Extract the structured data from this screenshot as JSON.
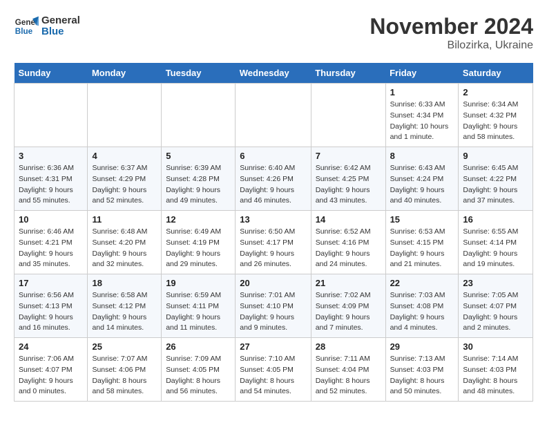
{
  "logo": {
    "line1": "General",
    "line2": "Blue"
  },
  "title": "November 2024",
  "location": "Bilozirka, Ukraine",
  "days_of_week": [
    "Sunday",
    "Monday",
    "Tuesday",
    "Wednesday",
    "Thursday",
    "Friday",
    "Saturday"
  ],
  "weeks": [
    [
      {
        "day": "",
        "detail": ""
      },
      {
        "day": "",
        "detail": ""
      },
      {
        "day": "",
        "detail": ""
      },
      {
        "day": "",
        "detail": ""
      },
      {
        "day": "",
        "detail": ""
      },
      {
        "day": "1",
        "detail": "Sunrise: 6:33 AM\nSunset: 4:34 PM\nDaylight: 10 hours and 1 minute."
      },
      {
        "day": "2",
        "detail": "Sunrise: 6:34 AM\nSunset: 4:32 PM\nDaylight: 9 hours and 58 minutes."
      }
    ],
    [
      {
        "day": "3",
        "detail": "Sunrise: 6:36 AM\nSunset: 4:31 PM\nDaylight: 9 hours and 55 minutes."
      },
      {
        "day": "4",
        "detail": "Sunrise: 6:37 AM\nSunset: 4:29 PM\nDaylight: 9 hours and 52 minutes."
      },
      {
        "day": "5",
        "detail": "Sunrise: 6:39 AM\nSunset: 4:28 PM\nDaylight: 9 hours and 49 minutes."
      },
      {
        "day": "6",
        "detail": "Sunrise: 6:40 AM\nSunset: 4:26 PM\nDaylight: 9 hours and 46 minutes."
      },
      {
        "day": "7",
        "detail": "Sunrise: 6:42 AM\nSunset: 4:25 PM\nDaylight: 9 hours and 43 minutes."
      },
      {
        "day": "8",
        "detail": "Sunrise: 6:43 AM\nSunset: 4:24 PM\nDaylight: 9 hours and 40 minutes."
      },
      {
        "day": "9",
        "detail": "Sunrise: 6:45 AM\nSunset: 4:22 PM\nDaylight: 9 hours and 37 minutes."
      }
    ],
    [
      {
        "day": "10",
        "detail": "Sunrise: 6:46 AM\nSunset: 4:21 PM\nDaylight: 9 hours and 35 minutes."
      },
      {
        "day": "11",
        "detail": "Sunrise: 6:48 AM\nSunset: 4:20 PM\nDaylight: 9 hours and 32 minutes."
      },
      {
        "day": "12",
        "detail": "Sunrise: 6:49 AM\nSunset: 4:19 PM\nDaylight: 9 hours and 29 minutes."
      },
      {
        "day": "13",
        "detail": "Sunrise: 6:50 AM\nSunset: 4:17 PM\nDaylight: 9 hours and 26 minutes."
      },
      {
        "day": "14",
        "detail": "Sunrise: 6:52 AM\nSunset: 4:16 PM\nDaylight: 9 hours and 24 minutes."
      },
      {
        "day": "15",
        "detail": "Sunrise: 6:53 AM\nSunset: 4:15 PM\nDaylight: 9 hours and 21 minutes."
      },
      {
        "day": "16",
        "detail": "Sunrise: 6:55 AM\nSunset: 4:14 PM\nDaylight: 9 hours and 19 minutes."
      }
    ],
    [
      {
        "day": "17",
        "detail": "Sunrise: 6:56 AM\nSunset: 4:13 PM\nDaylight: 9 hours and 16 minutes."
      },
      {
        "day": "18",
        "detail": "Sunrise: 6:58 AM\nSunset: 4:12 PM\nDaylight: 9 hours and 14 minutes."
      },
      {
        "day": "19",
        "detail": "Sunrise: 6:59 AM\nSunset: 4:11 PM\nDaylight: 9 hours and 11 minutes."
      },
      {
        "day": "20",
        "detail": "Sunrise: 7:01 AM\nSunset: 4:10 PM\nDaylight: 9 hours and 9 minutes."
      },
      {
        "day": "21",
        "detail": "Sunrise: 7:02 AM\nSunset: 4:09 PM\nDaylight: 9 hours and 7 minutes."
      },
      {
        "day": "22",
        "detail": "Sunrise: 7:03 AM\nSunset: 4:08 PM\nDaylight: 9 hours and 4 minutes."
      },
      {
        "day": "23",
        "detail": "Sunrise: 7:05 AM\nSunset: 4:07 PM\nDaylight: 9 hours and 2 minutes."
      }
    ],
    [
      {
        "day": "24",
        "detail": "Sunrise: 7:06 AM\nSunset: 4:07 PM\nDaylight: 9 hours and 0 minutes."
      },
      {
        "day": "25",
        "detail": "Sunrise: 7:07 AM\nSunset: 4:06 PM\nDaylight: 8 hours and 58 minutes."
      },
      {
        "day": "26",
        "detail": "Sunrise: 7:09 AM\nSunset: 4:05 PM\nDaylight: 8 hours and 56 minutes."
      },
      {
        "day": "27",
        "detail": "Sunrise: 7:10 AM\nSunset: 4:05 PM\nDaylight: 8 hours and 54 minutes."
      },
      {
        "day": "28",
        "detail": "Sunrise: 7:11 AM\nSunset: 4:04 PM\nDaylight: 8 hours and 52 minutes."
      },
      {
        "day": "29",
        "detail": "Sunrise: 7:13 AM\nSunset: 4:03 PM\nDaylight: 8 hours and 50 minutes."
      },
      {
        "day": "30",
        "detail": "Sunrise: 7:14 AM\nSunset: 4:03 PM\nDaylight: 8 hours and 48 minutes."
      }
    ]
  ]
}
